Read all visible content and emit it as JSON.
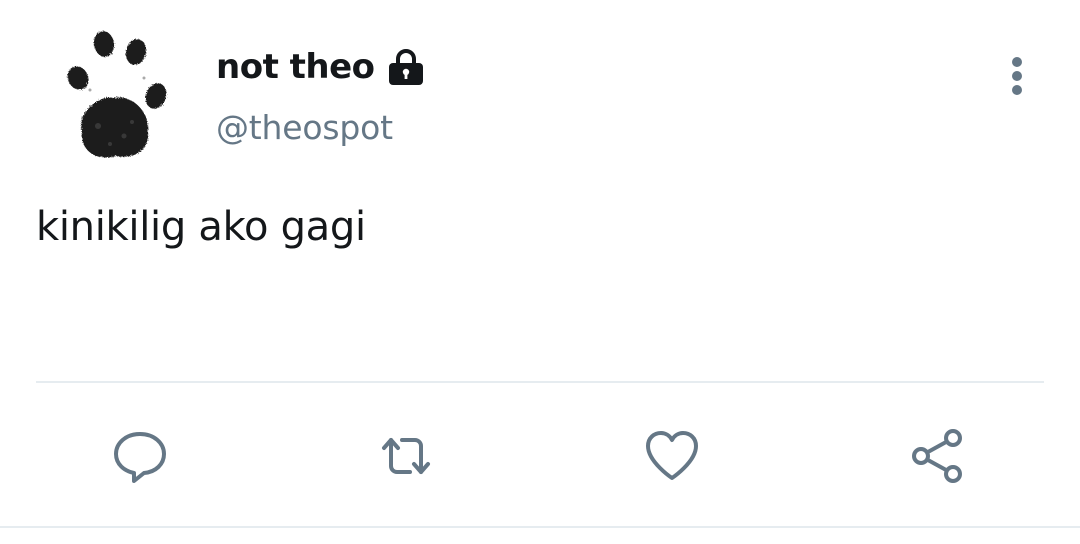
{
  "tweet": {
    "author": {
      "display_name": "not theo",
      "handle": "@theospot",
      "protected_icon": "lock-icon",
      "avatar_icon": "paw-print-icon"
    },
    "text": "kinikilig ako gagi",
    "menu_icon": "more-vertical-icon",
    "actions": [
      {
        "name": "reply",
        "icon": "speech-bubble-icon"
      },
      {
        "name": "retweet",
        "icon": "retweet-icon"
      },
      {
        "name": "like",
        "icon": "heart-icon"
      },
      {
        "name": "share",
        "icon": "share-icon"
      }
    ]
  },
  "colors": {
    "text_primary": "#14171a",
    "text_secondary": "#657786",
    "icon": "#657786",
    "divider": "#e6ecf0"
  }
}
